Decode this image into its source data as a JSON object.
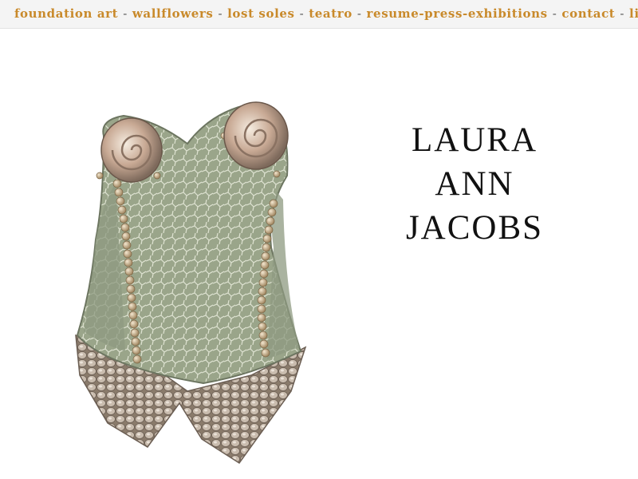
{
  "nav": {
    "items": [
      {
        "label": "foundation art"
      },
      {
        "label": "wallflowers"
      },
      {
        "label": "lost soles"
      },
      {
        "label": "teatro"
      },
      {
        "label": "resume-press-exhibitions"
      },
      {
        "label": "contact"
      },
      {
        "label": "lin"
      }
    ],
    "separator": "-",
    "link_color": "#c98a2b"
  },
  "title": {
    "line1": "LAURA",
    "line2": "ANN",
    "line3": "JACOBS"
  },
  "image": {
    "icon": "sculpture-bustier-image"
  }
}
